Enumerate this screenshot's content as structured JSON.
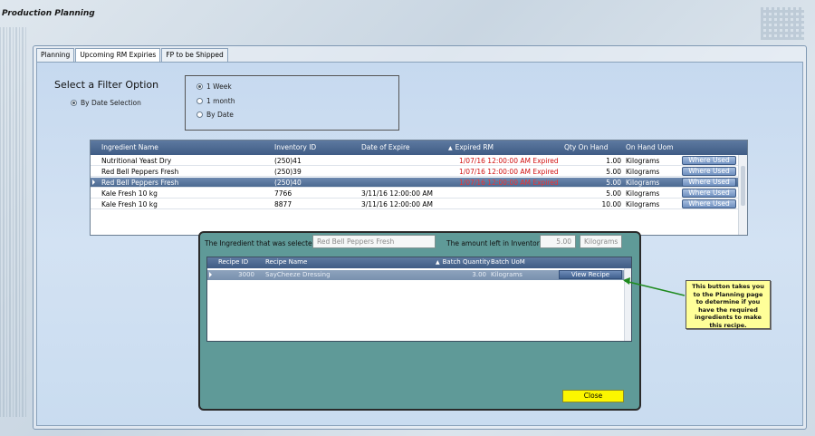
{
  "app": {
    "title": "Production Planning"
  },
  "tabs": [
    {
      "label": "Planning",
      "active": false
    },
    {
      "label": "Upcoming RM Expiries",
      "active": true
    },
    {
      "label": "FP to be Shipped",
      "active": false
    }
  ],
  "filter": {
    "title": "Select a Filter Option",
    "mode_label": "By Date Selection",
    "options": [
      {
        "label": "1 Week",
        "selected": true
      },
      {
        "label": "1 month",
        "selected": false
      },
      {
        "label": "By Date",
        "selected": false
      }
    ]
  },
  "grid": {
    "columns": [
      "Ingredient Name",
      "Inventory ID",
      "Date of Expire",
      "Expired RM",
      "Qty On Hand",
      "On Hand Uom"
    ],
    "rows": [
      {
        "name": "Nutritional Yeast Dry",
        "inventory_id": "(250)41",
        "date_of_expire": "",
        "expired_rm": "1/07/16 12:00:00 AM Expired",
        "qty": "1.00",
        "uom": "Kilograms",
        "action": "Where Used",
        "selected": false
      },
      {
        "name": "Red Bell Peppers Fresh",
        "inventory_id": "(250)39",
        "date_of_expire": "",
        "expired_rm": "1/07/16 12:00:00 AM Expired",
        "qty": "5.00",
        "uom": "Kilograms",
        "action": "Where Used",
        "selected": false
      },
      {
        "name": "Red Bell Peppers Fresh",
        "inventory_id": "(250)40",
        "date_of_expire": "",
        "expired_rm": "1/07/16 12:00:00 AM Expired",
        "qty": "5.00",
        "uom": "Kilograms",
        "action": "Where Used",
        "selected": true
      },
      {
        "name": "Kale Fresh 10 kg",
        "inventory_id": "7766",
        "date_of_expire": "3/11/16 12:00:00 AM",
        "expired_rm": "",
        "qty": "5.00",
        "uom": "Kilograms",
        "action": "Where Used",
        "selected": false
      },
      {
        "name": "Kale Fresh 10 kg",
        "inventory_id": "8877",
        "date_of_expire": "3/11/16 12:00:00 AM",
        "expired_rm": "",
        "qty": "10.00",
        "uom": "Kilograms",
        "action": "Where Used",
        "selected": false
      }
    ]
  },
  "popup": {
    "selected_label": "The Ingredient that was selected is:",
    "selected_value": "Red Bell Peppers Fresh",
    "amount_label": "The amount left in Inventory:",
    "amount_value": "5.00",
    "amount_uom": "Kilograms",
    "subgrid": {
      "columns": [
        "Recipe ID",
        "Recipe Name",
        "Batch Quantity",
        "Batch UoM"
      ],
      "rows": [
        {
          "recipe_id": "3000",
          "recipe_name": "SayCheeze Dressing",
          "batch_qty": "3.00",
          "batch_uom": "Kilograms",
          "action": "View Recipe"
        }
      ]
    },
    "close_label": "Close"
  },
  "callout": {
    "text": "This button takes you to the Planning page to determine if you have the required ingredients to make this recipe."
  },
  "colors": {
    "expired_text": "#d01010",
    "popup_bg": "#5f9a98",
    "close_button": "#fcf600",
    "callout_bg": "#ffff99",
    "header_bg": "#3f5c85"
  }
}
